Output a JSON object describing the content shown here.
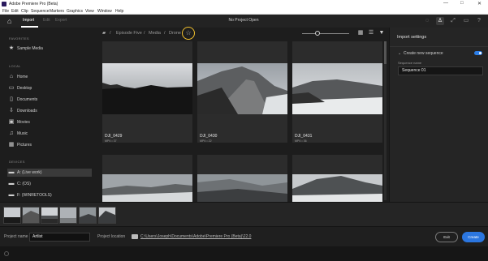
{
  "window": {
    "title": "Adobe Premiere Pro (Beta)",
    "controls": [
      "—",
      "□",
      "✕"
    ]
  },
  "menu": [
    "File",
    "Edit",
    "Clip",
    "Sequence",
    "Markers",
    "Graphics",
    "View",
    "Window",
    "Help"
  ],
  "header": {
    "tabs": [
      {
        "label": "Import",
        "active": true
      },
      {
        "label": "Edit",
        "active": false
      },
      {
        "label": "Export",
        "active": false
      }
    ],
    "project_status": "No Project Open",
    "icons": [
      "speech-icon",
      "person-icon",
      "maximize-icon",
      "chat-icon",
      "help-icon"
    ]
  },
  "sidebar": {
    "favorites_label": "FAVORITES",
    "favorites": [
      {
        "label": "Sample Media",
        "icon": "star-icon"
      }
    ],
    "local_label": "LOCAL",
    "local": [
      {
        "label": "Home",
        "icon": "home-icon"
      },
      {
        "label": "Desktop",
        "icon": "desktop-icon"
      },
      {
        "label": "Documents",
        "icon": "document-icon"
      },
      {
        "label": "Downloads",
        "icon": "download-icon"
      },
      {
        "label": "Movies",
        "icon": "film-icon"
      },
      {
        "label": "Music",
        "icon": "music-icon"
      },
      {
        "label": "Pictures",
        "icon": "picture-icon"
      }
    ],
    "devices_label": "DEVICES",
    "devices": [
      {
        "label": "A: (Live work)",
        "icon": "folder-icon",
        "selected": true
      },
      {
        "label": "C: (OS)",
        "icon": "folder-icon",
        "selected": false
      },
      {
        "label": "F: (WINRETOOLS)",
        "icon": "folder-icon",
        "selected": false
      }
    ]
  },
  "browser": {
    "breadcrumb": [
      "Episode Five",
      "Media",
      "Drone"
    ],
    "clips": [
      {
        "name": "DJI_0429",
        "meta": "MP4 • 37"
      },
      {
        "name": "DJI_0430",
        "meta": "MP4 • 22"
      },
      {
        "name": "DJI_0431",
        "meta": "MP4 • 36"
      }
    ]
  },
  "import_settings": {
    "heading": "Import settings",
    "create_sequence_label": "Create new sequence",
    "create_sequence_on": true,
    "sequence_name_label": "Sequence name",
    "sequence_name_value": "Sequence 01"
  },
  "footer": {
    "project_name_label": "Project name",
    "project_name_value": "Artlist",
    "project_location_label": "Project location",
    "project_location_value": "C:\\Users\\Joseph\\Documents\\Adobe\\Premiere Pro (Beta)\\22.0",
    "exit_label": "Exit",
    "create_label": "Create"
  },
  "colors": {
    "accent": "#2b76e0",
    "highlight_ring": "#f2c12e",
    "background": "#1d1d1d"
  }
}
